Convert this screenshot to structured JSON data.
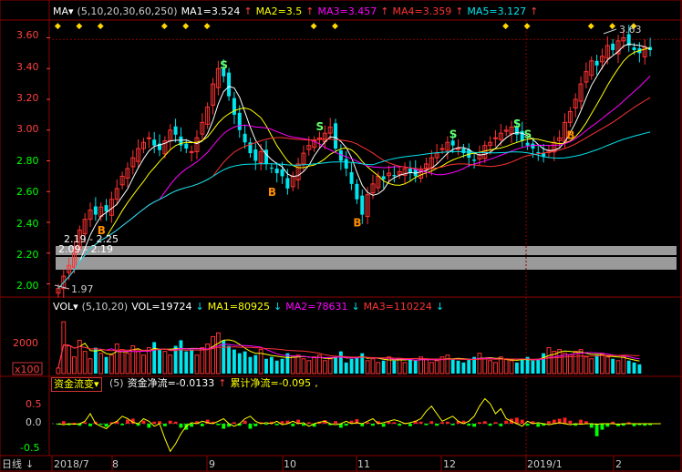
{
  "price_header": {
    "indicator": "MA▾",
    "params": "(5,10,20,30,60,250)",
    "ma1": "MA1=3.524",
    "ma2": "MA2=3.5",
    "ma3": "MA3=3.457",
    "ma4": "MA4=3.359",
    "ma5": "MA5=3.127",
    "arrow_up": "↑"
  },
  "vol_header": {
    "indicator": "VOL▾",
    "params": "(5,10,20)",
    "vol": "VOL=19724",
    "ma1": "MA1=80925",
    "ma2": "MA2=78631",
    "ma3": "MA3=110224",
    "arrow_down": "↓"
  },
  "flow_header": {
    "selector": "资金流变▾",
    "params": "(5)",
    "net": "资金净流=-0.0133",
    "cum": "累计净流=-0.095",
    "tail": ",",
    "arrow_up": "↑"
  },
  "price_axis": [
    "3.60",
    "3.40",
    "3.20",
    "3.00",
    "2.80",
    "2.60",
    "2.40",
    "2.20",
    "2.00"
  ],
  "vol_axis": [
    "2000",
    "x100"
  ],
  "flow_axis": [
    "0.5",
    "0.0",
    "-0.5"
  ],
  "x_axis": {
    "period": "日线",
    "period_arrow": "↓",
    "labels": [
      "2018/7",
      "8",
      "9",
      "10",
      "11",
      "12",
      "2019/1",
      "2"
    ]
  },
  "annotations": {
    "high": "3.63",
    "low": "1.97",
    "range1": "2.19 - 2.25",
    "range2": "2.09 - 2.19",
    "buy": "B",
    "sell": "S"
  },
  "colors": {
    "up": "#ff3232",
    "down": "#00e5ee",
    "ma1": "#ffffff",
    "ma2": "#ffff00",
    "ma3": "#ff00ff",
    "ma4": "#ff3333",
    "ma5": "#00e5ee",
    "grid": "#8b0000",
    "axis_up": "#ff4040",
    "axis_down": "#00ff00"
  },
  "chart_data": [
    {
      "type": "candlestick",
      "ylim": [
        1.95,
        3.68
      ],
      "months": [
        "2018/7",
        "8",
        "9",
        "10",
        "11",
        "12",
        "2019/1",
        "2"
      ],
      "close_series": [
        1.97,
        2.05,
        2.12,
        2.22,
        2.35,
        2.42,
        2.48,
        2.45,
        2.5,
        2.47,
        2.55,
        2.62,
        2.7,
        2.75,
        2.82,
        2.88,
        2.92,
        2.95,
        2.9,
        2.87,
        2.93,
        3.0,
        2.97,
        2.9,
        2.88,
        2.86,
        2.95,
        3.05,
        3.15,
        3.3,
        3.4,
        3.35,
        3.22,
        3.1,
        3.0,
        2.92,
        2.85,
        2.8,
        2.86,
        2.78,
        2.75,
        2.72,
        2.7,
        2.62,
        2.7,
        2.78,
        2.85,
        2.9,
        2.93,
        2.95,
        2.98,
        3.02,
        2.88,
        2.8,
        2.75,
        2.65,
        2.55,
        2.45,
        2.58,
        2.65,
        2.7,
        2.68,
        2.72,
        2.7,
        2.73,
        2.75,
        2.72,
        2.7,
        2.74,
        2.78,
        2.82,
        2.85,
        2.88,
        2.92,
        2.9,
        2.88,
        2.85,
        2.82,
        2.8,
        2.84,
        2.9,
        2.92,
        2.95,
        2.98,
        3.0,
        3.02,
        2.97,
        2.93,
        2.9,
        2.88,
        2.85,
        2.83,
        2.87,
        2.92,
        2.95,
        3.05,
        3.12,
        3.2,
        3.3,
        3.38,
        3.45,
        3.42,
        3.48,
        3.55,
        3.52,
        3.58,
        3.6,
        3.55,
        3.52,
        3.5,
        3.54,
        3.52
      ],
      "annotations": {
        "high": 3.63,
        "low": 1.97
      }
    },
    {
      "type": "bar",
      "title": "VOL",
      "ylim": [
        0,
        3200
      ],
      "values": [
        300,
        2800,
        1500,
        900,
        1800,
        1200,
        800,
        1400,
        1100,
        900,
        1000,
        1600,
        1300,
        1100,
        1500,
        1200,
        1000,
        1400,
        1700,
        1300,
        1200,
        1000,
        1500,
        1800,
        1200,
        1300,
        1000,
        1400,
        1600,
        2000,
        2200,
        1800,
        1500,
        1300,
        1100,
        1200,
        900,
        1000,
        1300,
        800,
        900,
        700,
        800,
        1100,
        900,
        1000,
        800,
        700,
        900,
        1000,
        700,
        800,
        900,
        1200,
        600,
        800,
        900,
        1100,
        700,
        800,
        600,
        700,
        900,
        700,
        800,
        600,
        800,
        700,
        900,
        800,
        600,
        700,
        900,
        1000,
        800,
        700,
        600,
        800,
        900,
        1100,
        800,
        700,
        600,
        900,
        800,
        700,
        600,
        800,
        900,
        700,
        800,
        1100,
        1400,
        1200,
        1300,
        1100,
        1000,
        1200,
        1300,
        900,
        800,
        1000,
        1100,
        900,
        800,
        700,
        900,
        700,
        600,
        500
      ]
    },
    {
      "type": "bar",
      "title": "资金流变",
      "ylim": [
        -0.6,
        0.6
      ],
      "values": [
        -0.02,
        0.05,
        -0.03,
        0.02,
        -0.04,
        0.03,
        -0.05,
        0.04,
        -0.02,
        -0.06,
        0.03,
        0.05,
        -0.03,
        0.08,
        0.1,
        -0.04,
        0.06,
        -0.08,
        0.04,
        0.05,
        -0.05,
        0.06,
        0.04,
        -0.08,
        -0.12,
        -0.06,
        0.05,
        -0.05,
        0.08,
        0.04,
        -0.03,
        -0.1,
        -0.06,
        0.03,
        -0.04,
        0.06,
        -0.1,
        -0.05,
        0.03,
        -0.02,
        0.04,
        -0.03,
        0.05,
        0.06,
        -0.05,
        0.08,
        -0.04,
        0.03,
        -0.06,
        0.04,
        0.07,
        -0.03,
        0.05,
        -0.08,
        -0.04,
        0.06,
        0.09,
        -0.05,
        0.03,
        -0.04,
        0.05,
        -0.06,
        0.04,
        0.03,
        -0.04,
        0.02,
        -0.05,
        0.06,
        0.04,
        -0.03,
        0.05,
        -0.04,
        0.03,
        0.04,
        -0.03,
        0.05,
        0.06,
        -0.04,
        -0.06,
        0.03,
        0.05,
        -0.04,
        0.03,
        -0.05,
        0.06,
        0.1,
        0.12,
        0.08,
        -0.04,
        0.05,
        -0.06,
        -0.04,
        0.05,
        0.08,
        0.1,
        0.12,
        0.06,
        -0.04,
        0.08,
        0.05,
        -0.08,
        -0.25,
        -0.12,
        -0.06,
        0.04,
        -0.05,
        -0.04,
        0.03,
        -0.05,
        -0.03,
        -0.04,
        -0.03
      ],
      "line": [
        0.0,
        -0.02,
        0.0,
        -0.01,
        0.0,
        0.05,
        0.2,
        0.0,
        -0.05,
        -0.1,
        0.0,
        0.05,
        0.15,
        0.1,
        0.03,
        0.0,
        0.1,
        0.05,
        -0.05,
        0.0,
        -0.3,
        -0.55,
        -0.4,
        -0.2,
        -0.05,
        0.02,
        0.0,
        0.05,
        0.02,
        0.0,
        0.05,
        0.1,
        0.0,
        -0.05,
        0.0,
        0.1,
        0.15,
        0.05,
        0.0,
        0.02,
        0.0,
        0.05,
        -0.02,
        0.0,
        0.05,
        0.0,
        0.02,
        -0.05,
        0.0,
        0.03,
        0.05,
        0.0,
        -0.02,
        0.0,
        0.05,
        0.0,
        0.02,
        0.0,
        0.05,
        0.1,
        0.0,
        0.02,
        0.05,
        0.08,
        0.05,
        0.0,
        0.02,
        0.05,
        0.1,
        0.25,
        0.35,
        0.2,
        0.05,
        0.1,
        0.15,
        0.05,
        0.0,
        0.05,
        0.15,
        0.35,
        0.5,
        0.4,
        0.2,
        0.3,
        0.1,
        0.05,
        0.0,
        -0.05,
        0.05,
        0.0,
        0.02,
        0.0,
        -0.02,
        0.0,
        0.02,
        0.0,
        -0.02,
        0.0,
        -0.01,
        0.0,
        0.0,
        -0.01,
        0.0,
        0.0,
        0.0,
        -0.01,
        0.0,
        0.0,
        0.0,
        0.0,
        0.0,
        0.0,
        0.0,
        0.0
      ]
    }
  ]
}
